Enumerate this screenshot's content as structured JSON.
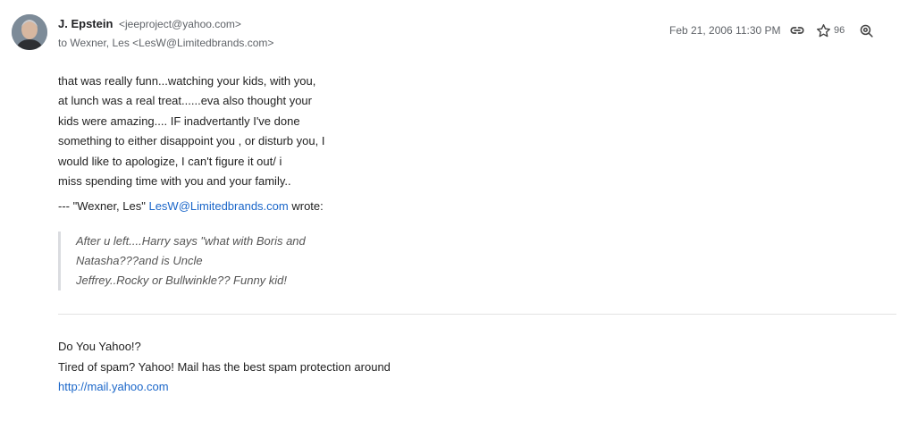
{
  "message": {
    "sender_name": "J. Epstein",
    "sender_email": "<jeeproject@yahoo.com>",
    "recipients": "to Wexner, Les <LesW@Limitedbrands.com>",
    "timestamp": "Feb 21, 2006 11:30 PM",
    "star_count": "96",
    "icons": [
      "link-icon",
      "star-icon",
      "zoom-icon"
    ],
    "body_lines": [
      "that was really funn...watching your kids, with you,",
      "at lunch was a real treat......eva also thought your",
      "kids were amazing.... IF inadvertantly I've done",
      "something to either disappoint you , or disturb you, I",
      "would like to apologize, I can't figure it out/ i",
      "miss spending time with you and your family.."
    ],
    "quote_intro": {
      "prefix": "--- \"Wexner, Les\" ",
      "email": "LesW@Limitedbrands.com",
      "suffix": " wrote:"
    },
    "quoted_lines": [
      "After u left....Harry says \"what with Boris and",
      "Natasha???and is Uncle",
      "Jeffrey..Rocky or Bullwinkle?? Funny kid!"
    ],
    "footer": {
      "line1": "Do You Yahoo!?",
      "line2": "Tired of spam? Yahoo! Mail has the best spam protection around",
      "link": "http://mail.yahoo.com"
    }
  },
  "colors": {
    "link": "#1a66c9",
    "muted_text": "#5f6368",
    "quote_text": "#555555",
    "divider": "#e3e3e3"
  }
}
